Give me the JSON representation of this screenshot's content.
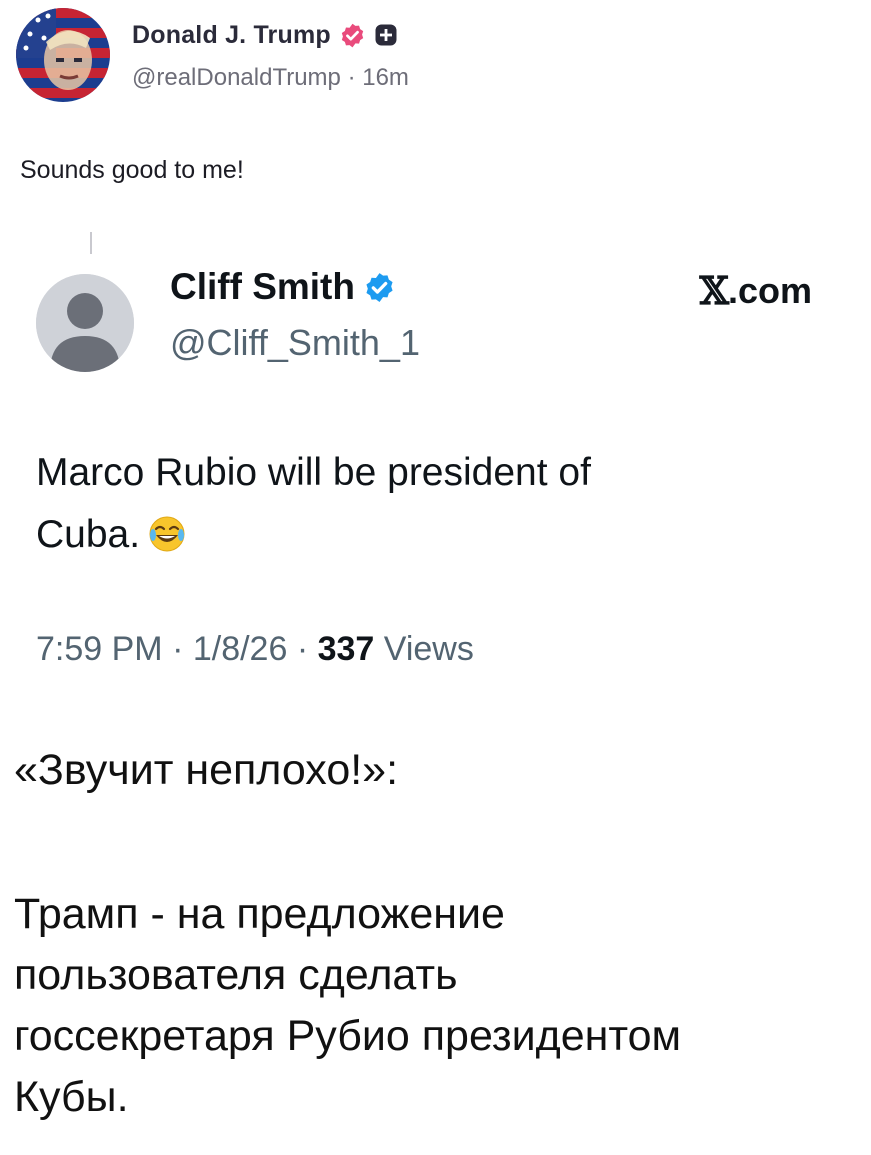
{
  "original_post": {
    "author_name": "Donald J. Trump",
    "handle": "@realDonaldTrump",
    "separator": "·",
    "time_ago": "16m",
    "text": "Sounds good to me!",
    "verified_color": "#e94b7c",
    "avatar_icon": "flag-portrait-avatar"
  },
  "quoted_tweet": {
    "author_name": "Cliff Smith",
    "handle": "@Cliff_Smith_1",
    "source": ".com",
    "verified_color": "#1d9bf0",
    "text_line1": "Marco Rubio will be president of",
    "text_line2": "Cuba.",
    "emoji": "laughing-tears-emoji",
    "time": "7:59 PM",
    "date": "1/8/26",
    "meta_sep": " · ",
    "views_count": "337",
    "views_label": "Views"
  },
  "caption": {
    "quote": "«Звучит неплохо!»:",
    "lines": [
      "Трамп - на предложение",
      "пользователя сделать",
      "госсекретаря Рубио президентом",
      "Кубы."
    ]
  }
}
